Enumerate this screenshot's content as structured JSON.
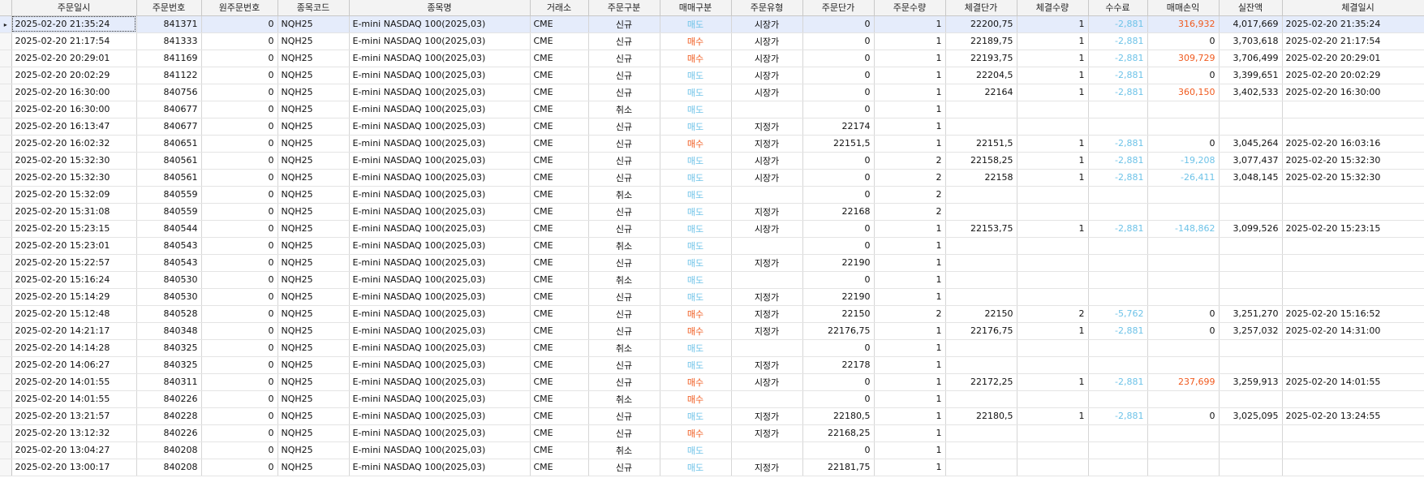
{
  "columns": [
    "주문일시",
    "주문번호",
    "원주문번호",
    "종목코드",
    "종목명",
    "거래소",
    "주문구분",
    "매매구분",
    "주문유형",
    "주문단가",
    "주문수량",
    "체결단가",
    "체결수량",
    "수수료",
    "매매손익",
    "실잔액",
    "체결일시"
  ],
  "selected_row_marker": "▸",
  "rows": [
    [
      "2025-02-20 21:35:24",
      "841371",
      "0",
      "NQH25",
      "E-mini NASDAQ 100(2025,03)",
      "CME",
      "신규",
      "매도",
      "시장가",
      "0",
      "1",
      "22200,75",
      "1",
      "-2,881",
      "316,932",
      "4,017,669",
      "2025-02-20 21:35:24"
    ],
    [
      "2025-02-20 21:17:54",
      "841333",
      "0",
      "NQH25",
      "E-mini NASDAQ 100(2025,03)",
      "CME",
      "신규",
      "매수",
      "시장가",
      "0",
      "1",
      "22189,75",
      "1",
      "-2,881",
      "0",
      "3,703,618",
      "2025-02-20 21:17:54"
    ],
    [
      "2025-02-20 20:29:01",
      "841169",
      "0",
      "NQH25",
      "E-mini NASDAQ 100(2025,03)",
      "CME",
      "신규",
      "매수",
      "시장가",
      "0",
      "1",
      "22193,75",
      "1",
      "-2,881",
      "309,729",
      "3,706,499",
      "2025-02-20 20:29:01"
    ],
    [
      "2025-02-20 20:02:29",
      "841122",
      "0",
      "NQH25",
      "E-mini NASDAQ 100(2025,03)",
      "CME",
      "신규",
      "매도",
      "시장가",
      "0",
      "1",
      "22204,5",
      "1",
      "-2,881",
      "0",
      "3,399,651",
      "2025-02-20 20:02:29"
    ],
    [
      "2025-02-20 16:30:00",
      "840756",
      "0",
      "NQH25",
      "E-mini NASDAQ 100(2025,03)",
      "CME",
      "신규",
      "매도",
      "시장가",
      "0",
      "1",
      "22164",
      "1",
      "-2,881",
      "360,150",
      "3,402,533",
      "2025-02-20 16:30:00"
    ],
    [
      "2025-02-20 16:30:00",
      "840677",
      "0",
      "NQH25",
      "E-mini NASDAQ 100(2025,03)",
      "CME",
      "취소",
      "매도",
      "",
      "0",
      "1",
      "",
      "",
      "",
      "",
      "",
      ""
    ],
    [
      "2025-02-20 16:13:47",
      "840677",
      "0",
      "NQH25",
      "E-mini NASDAQ 100(2025,03)",
      "CME",
      "신규",
      "매도",
      "지정가",
      "22174",
      "1",
      "",
      "",
      "",
      "",
      "",
      ""
    ],
    [
      "2025-02-20 16:02:32",
      "840651",
      "0",
      "NQH25",
      "E-mini NASDAQ 100(2025,03)",
      "CME",
      "신규",
      "매수",
      "지정가",
      "22151,5",
      "1",
      "22151,5",
      "1",
      "-2,881",
      "0",
      "3,045,264",
      "2025-02-20 16:03:16"
    ],
    [
      "2025-02-20 15:32:30",
      "840561",
      "0",
      "NQH25",
      "E-mini NASDAQ 100(2025,03)",
      "CME",
      "신규",
      "매도",
      "시장가",
      "0",
      "2",
      "22158,25",
      "1",
      "-2,881",
      "-19,208",
      "3,077,437",
      "2025-02-20 15:32:30"
    ],
    [
      "2025-02-20 15:32:30",
      "840561",
      "0",
      "NQH25",
      "E-mini NASDAQ 100(2025,03)",
      "CME",
      "신규",
      "매도",
      "시장가",
      "0",
      "2",
      "22158",
      "1",
      "-2,881",
      "-26,411",
      "3,048,145",
      "2025-02-20 15:32:30"
    ],
    [
      "2025-02-20 15:32:09",
      "840559",
      "0",
      "NQH25",
      "E-mini NASDAQ 100(2025,03)",
      "CME",
      "취소",
      "매도",
      "",
      "0",
      "2",
      "",
      "",
      "",
      "",
      "",
      ""
    ],
    [
      "2025-02-20 15:31:08",
      "840559",
      "0",
      "NQH25",
      "E-mini NASDAQ 100(2025,03)",
      "CME",
      "신규",
      "매도",
      "지정가",
      "22168",
      "2",
      "",
      "",
      "",
      "",
      "",
      ""
    ],
    [
      "2025-02-20 15:23:15",
      "840544",
      "0",
      "NQH25",
      "E-mini NASDAQ 100(2025,03)",
      "CME",
      "신규",
      "매도",
      "시장가",
      "0",
      "1",
      "22153,75",
      "1",
      "-2,881",
      "-148,862",
      "3,099,526",
      "2025-02-20 15:23:15"
    ],
    [
      "2025-02-20 15:23:01",
      "840543",
      "0",
      "NQH25",
      "E-mini NASDAQ 100(2025,03)",
      "CME",
      "취소",
      "매도",
      "",
      "0",
      "1",
      "",
      "",
      "",
      "",
      "",
      ""
    ],
    [
      "2025-02-20 15:22:57",
      "840543",
      "0",
      "NQH25",
      "E-mini NASDAQ 100(2025,03)",
      "CME",
      "신규",
      "매도",
      "지정가",
      "22190",
      "1",
      "",
      "",
      "",
      "",
      "",
      ""
    ],
    [
      "2025-02-20 15:16:24",
      "840530",
      "0",
      "NQH25",
      "E-mini NASDAQ 100(2025,03)",
      "CME",
      "취소",
      "매도",
      "",
      "0",
      "1",
      "",
      "",
      "",
      "",
      "",
      ""
    ],
    [
      "2025-02-20 15:14:29",
      "840530",
      "0",
      "NQH25",
      "E-mini NASDAQ 100(2025,03)",
      "CME",
      "신규",
      "매도",
      "지정가",
      "22190",
      "1",
      "",
      "",
      "",
      "",
      "",
      ""
    ],
    [
      "2025-02-20 15:12:48",
      "840528",
      "0",
      "NQH25",
      "E-mini NASDAQ 100(2025,03)",
      "CME",
      "신규",
      "매수",
      "지정가",
      "22150",
      "2",
      "22150",
      "2",
      "-5,762",
      "0",
      "3,251,270",
      "2025-02-20 15:16:52"
    ],
    [
      "2025-02-20 14:21:17",
      "840348",
      "0",
      "NQH25",
      "E-mini NASDAQ 100(2025,03)",
      "CME",
      "신규",
      "매수",
      "지정가",
      "22176,75",
      "1",
      "22176,75",
      "1",
      "-2,881",
      "0",
      "3,257,032",
      "2025-02-20 14:31:00"
    ],
    [
      "2025-02-20 14:14:28",
      "840325",
      "0",
      "NQH25",
      "E-mini NASDAQ 100(2025,03)",
      "CME",
      "취소",
      "매도",
      "",
      "0",
      "1",
      "",
      "",
      "",
      "",
      "",
      ""
    ],
    [
      "2025-02-20 14:06:27",
      "840325",
      "0",
      "NQH25",
      "E-mini NASDAQ 100(2025,03)",
      "CME",
      "신규",
      "매도",
      "지정가",
      "22178",
      "1",
      "",
      "",
      "",
      "",
      "",
      ""
    ],
    [
      "2025-02-20 14:01:55",
      "840311",
      "0",
      "NQH25",
      "E-mini NASDAQ 100(2025,03)",
      "CME",
      "신규",
      "매수",
      "시장가",
      "0",
      "1",
      "22172,25",
      "1",
      "-2,881",
      "237,699",
      "3,259,913",
      "2025-02-20 14:01:55"
    ],
    [
      "2025-02-20 14:01:55",
      "840226",
      "0",
      "NQH25",
      "E-mini NASDAQ 100(2025,03)",
      "CME",
      "취소",
      "매수",
      "",
      "0",
      "1",
      "",
      "",
      "",
      "",
      "",
      ""
    ],
    [
      "2025-02-20 13:21:57",
      "840228",
      "0",
      "NQH25",
      "E-mini NASDAQ 100(2025,03)",
      "CME",
      "신규",
      "매도",
      "지정가",
      "22180,5",
      "1",
      "22180,5",
      "1",
      "-2,881",
      "0",
      "3,025,095",
      "2025-02-20 13:24:55"
    ],
    [
      "2025-02-20 13:12:32",
      "840226",
      "0",
      "NQH25",
      "E-mini NASDAQ 100(2025,03)",
      "CME",
      "신규",
      "매수",
      "지정가",
      "22168,25",
      "1",
      "",
      "",
      "",
      "",
      "",
      ""
    ],
    [
      "2025-02-20 13:04:27",
      "840208",
      "0",
      "NQH25",
      "E-mini NASDAQ 100(2025,03)",
      "CME",
      "취소",
      "매도",
      "",
      "0",
      "1",
      "",
      "",
      "",
      "",
      "",
      ""
    ],
    [
      "2025-02-20 13:00:17",
      "840208",
      "0",
      "NQH25",
      "E-mini NASDAQ 100(2025,03)",
      "CME",
      "신규",
      "매도",
      "지정가",
      "22181,75",
      "1",
      "",
      "",
      "",
      "",
      "",
      ""
    ]
  ],
  "colors": {
    "sell": "#6ec3e8",
    "buy": "#f05a1e",
    "selected_row_bg": "#e5ecfb",
    "header_bg": "#f3f3f3"
  },
  "side_labels": {
    "sell": "매도",
    "buy": "매수"
  }
}
